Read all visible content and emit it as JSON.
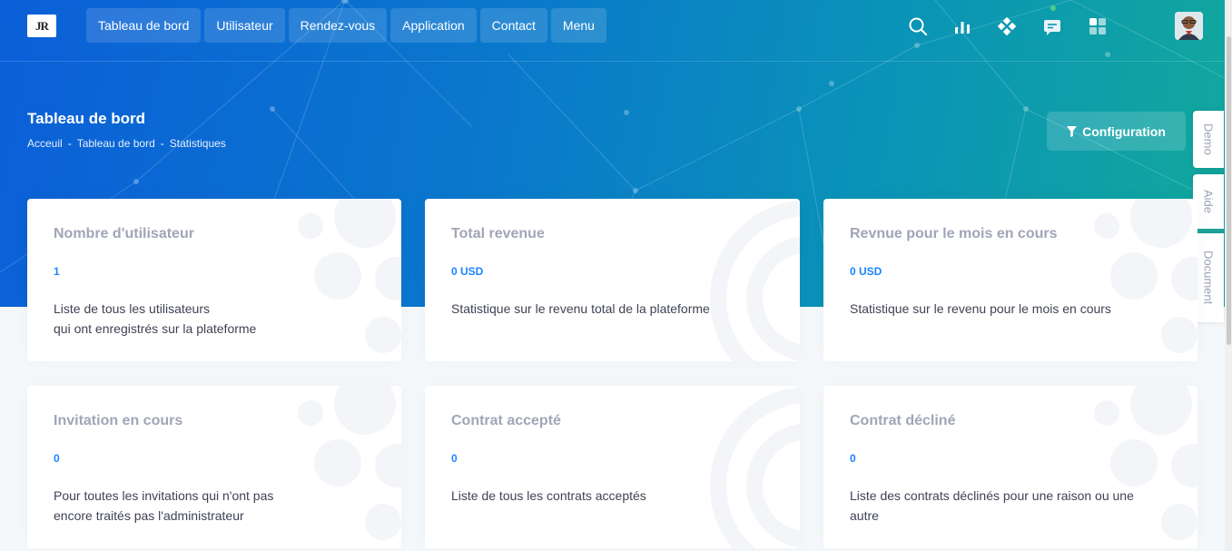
{
  "logo": {
    "text": "JR"
  },
  "nav": [
    {
      "label": "Tableau de bord"
    },
    {
      "label": "Utilisateur"
    },
    {
      "label": "Rendez-vous"
    },
    {
      "label": "Application"
    },
    {
      "label": "Contact"
    },
    {
      "label": "Menu"
    }
  ],
  "header_icons": [
    "search-icon",
    "bar-chart-icon",
    "apps-icon",
    "chat-icon",
    "grid-icon"
  ],
  "page": {
    "title": "Tableau de bord",
    "breadcrumb": [
      "Acceuil",
      "Tableau de bord",
      "Statistiques"
    ],
    "breadcrumb_sep": "-"
  },
  "config_button": {
    "label": "Configuration",
    "icon": "filter-icon"
  },
  "side_tabs": [
    {
      "label": "Demo"
    },
    {
      "label": "Aide"
    },
    {
      "label": "Document"
    }
  ],
  "cards": [
    {
      "title": "Nombre d'utilisateur",
      "value": "1",
      "description": "Liste de tous les utilisateurs\nqui ont enregistrés sur la plateforme"
    },
    {
      "title": "Total revenue",
      "value": "0 USD",
      "description": "Statistique sur le revenu total de la plateforme"
    },
    {
      "title": "Revnue pour le mois en cours",
      "value": "0 USD",
      "description": "Statistique sur le revenu pour le mois en cours"
    },
    {
      "title": "Invitation en cours",
      "value": "0",
      "description": "Pour toutes les invitations qui n'ont pas\nencore traités pas l'administrateur"
    },
    {
      "title": "Contrat accepté",
      "value": "0",
      "description": "Liste de tous les contrats acceptés"
    },
    {
      "title": "Contrat décliné",
      "value": "0",
      "description": "Liste des contrats déclinés pour une raison ou une\nautre"
    }
  ],
  "colors": {
    "accent": "#1b84ff",
    "teal": "#20a59a",
    "muted_title": "#a1a5b7"
  }
}
